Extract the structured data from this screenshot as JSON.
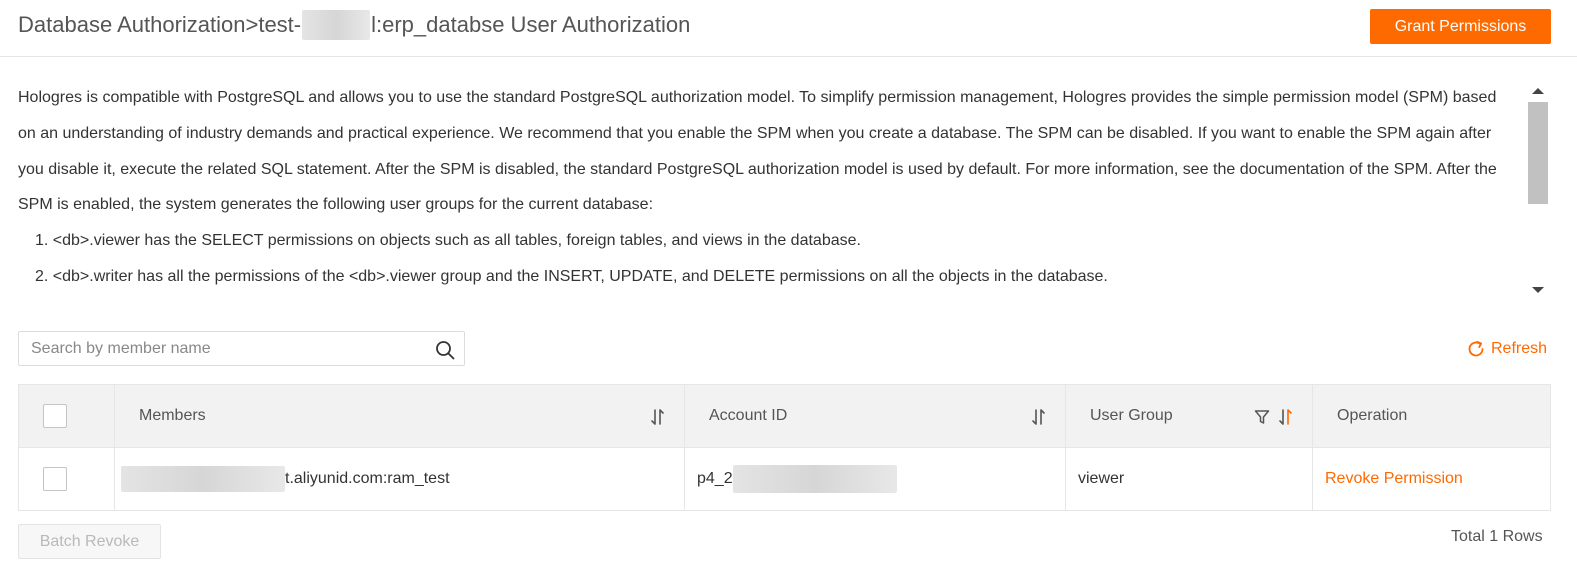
{
  "header": {
    "title_prefix": "Database Authorization>test-",
    "title_suffix": "l:erp_databse User Authorization",
    "grant_label": "Grant Permissions"
  },
  "description": {
    "paragraph": "Hologres is compatible with PostgreSQL and allows you to use the standard PostgreSQL authorization model. To simplify permission management, Hologres provides the simple permission model (SPM) based on an understanding of industry demands and practical experience. We recommend that you enable the SPM when you create a database. The SPM can be disabled. If you want to enable the SPM again after you disable it, execute the related SQL statement. After the SPM is disabled, the standard PostgreSQL authorization model is used by default. For more information, see the documentation of the SPM. After the SPM is enabled, the system generates the following user groups for the current database:",
    "items": [
      "1. <db>.viewer has the SELECT permissions on objects such as all tables, foreign tables, and views in the database.",
      "2. <db>.writer has all the permissions of the <db>.viewer group and the INSERT, UPDATE, and DELETE permissions on all the objects in the database."
    ]
  },
  "toolbar": {
    "search_placeholder": "Search by member name",
    "search_value": "",
    "refresh_label": "Refresh"
  },
  "table": {
    "columns": [
      "Members",
      "Account ID",
      "User Group",
      "Operation"
    ],
    "rows": [
      {
        "member_suffix": "t.aliyunid.com:ram_test",
        "account_prefix": "p4_2",
        "account_suffix": "",
        "user_group": "viewer",
        "operation": "Revoke Permission"
      }
    ]
  },
  "footer": {
    "batch_revoke_label": "Batch Revoke",
    "total_label": "Total 1 Rows"
  },
  "colors": {
    "accent": "#ff6a00",
    "header_bg": "#f2f2f2",
    "border": "#e6e6e6"
  },
  "icons": [
    "search-icon",
    "refresh-icon",
    "sort-icon",
    "filter-icon",
    "scroll-up-arrow-icon",
    "scroll-down-arrow-icon"
  ]
}
